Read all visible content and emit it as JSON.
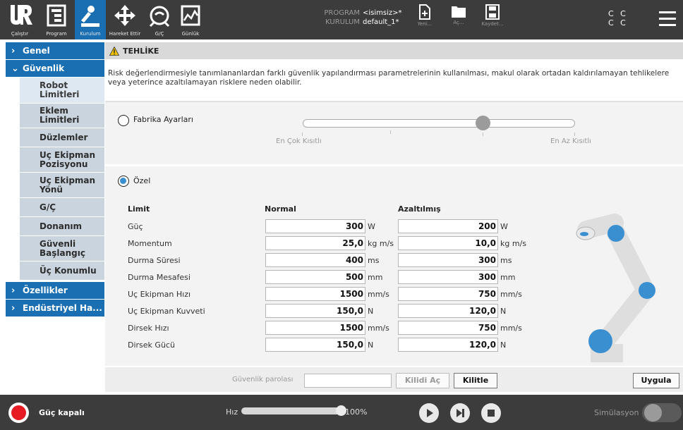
{
  "toolbar": {
    "items": [
      {
        "label": "Çalıştır",
        "icon": "ur-logo-icon"
      },
      {
        "label": "Program",
        "icon": "program-icon"
      },
      {
        "label": "Kurulum",
        "icon": "installation-icon"
      },
      {
        "label": "Hareket Ettir",
        "icon": "move-icon"
      },
      {
        "label": "G/Ç",
        "icon": "io-icon"
      },
      {
        "label": "Günlük",
        "icon": "log-icon"
      }
    ],
    "program_key": "PROGRAM",
    "program_value": "<isimsiz>*",
    "installation_key": "KURULUM",
    "installation_value": "default_1*",
    "new_label": "Yeni...",
    "open_label": "Aç...",
    "save_label": "Kaydet...",
    "cc_line1": "C C",
    "cc_line2": "C C"
  },
  "sidebar": {
    "general": "Genel",
    "safety": "Güvenlik",
    "safety_items": [
      "Robot Limitleri",
      "Eklem Limitleri",
      "Düzlemler",
      "Uç Ekipman Pozisyonu",
      "Uç Ekipman Yönü",
      "G/Ç",
      "Donanım",
      "Güvenli Başlangıç",
      "Üç Konumlu"
    ],
    "features": "Özellikler",
    "industrial": "Endüstriyel Ha..."
  },
  "warning": {
    "title": "TEHLİKE",
    "text": "Risk değerlendirmesiyle tanımlananlardan farklı güvenlik yapılandırması parametrelerinin kullanılması, makul olarak ortadan kaldırılamayan tehlikelere veya yeterince azaltılamayan risklere neden olabilir."
  },
  "factory": {
    "label": "Fabrika Ayarları",
    "most_restricted": "En Çok Kısıtlı",
    "least_restricted": "En Az Kısıtlı",
    "slider_position": 0.66
  },
  "custom": {
    "label": "Özel",
    "col_limit": "Limit",
    "col_normal": "Normal",
    "col_reduced": "Azaltılmış",
    "rows": [
      {
        "name": "Güç",
        "normal": "300",
        "reduced": "200",
        "unit": "W"
      },
      {
        "name": "Momentum",
        "normal": "25,0",
        "reduced": "10,0",
        "unit": "kg m/s"
      },
      {
        "name": "Durma Süresi",
        "normal": "400",
        "reduced": "300",
        "unit": "ms"
      },
      {
        "name": "Durma Mesafesi",
        "normal": "500",
        "reduced": "300",
        "unit": "mm"
      },
      {
        "name": "Uç Ekipman Hızı",
        "normal": "1500",
        "reduced": "750",
        "unit": "mm/s"
      },
      {
        "name": "Uç Ekipman Kuvveti",
        "normal": "150,0",
        "reduced": "120,0",
        "unit": "N"
      },
      {
        "name": "Dirsek Hızı",
        "normal": "1500",
        "reduced": "750",
        "unit": "mm/s"
      },
      {
        "name": "Dirsek Gücü",
        "normal": "150,0",
        "reduced": "120,0",
        "unit": "N"
      }
    ]
  },
  "lock": {
    "password_label": "Güvenlik parolası",
    "unlock": "Kilidi Aç",
    "lock": "Kilitle",
    "apply": "Uygula"
  },
  "status": {
    "power": "Güç kapalı",
    "speed_label": "Hız",
    "speed_value": "100%",
    "speed_fraction": 1.0,
    "simulation": "Simülasyon"
  },
  "colors": {
    "accent": "#1a6fb3",
    "bar": "#3c3c3c",
    "power_off": "#e61b23"
  }
}
